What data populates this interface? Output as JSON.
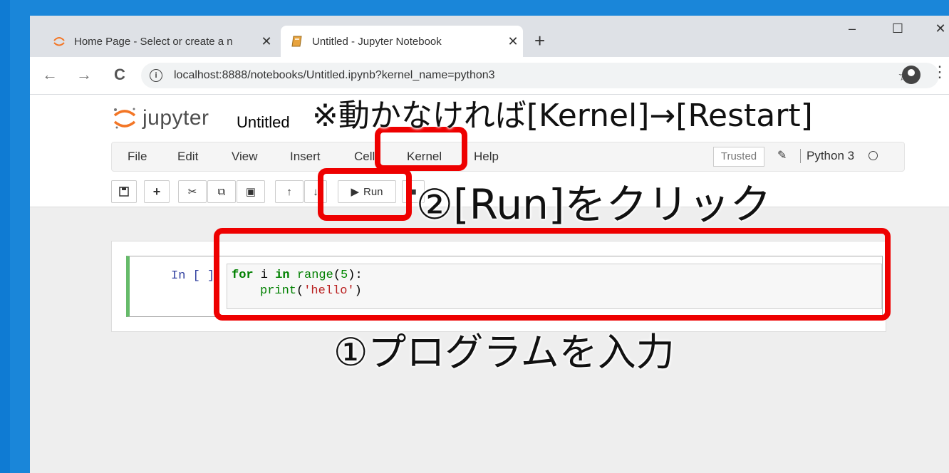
{
  "browser": {
    "tabs": [
      {
        "title": "Home Page - Select or create a n",
        "active": false,
        "close": "✕"
      },
      {
        "title": "Untitled - Jupyter Notebook",
        "active": true,
        "close": "✕"
      }
    ],
    "new_tab": "+",
    "window_controls": {
      "minimize": "–",
      "maximize": "☐",
      "close": "✕"
    },
    "nav": {
      "back": "←",
      "forward": "→",
      "reload": "C"
    },
    "url": "localhost:8888/notebooks/Untitled.ipynb?kernel_name=python3",
    "star": "☆",
    "menu": "⋮"
  },
  "jupyter": {
    "logo_text": "jupyter",
    "notebook_name": "Untitled",
    "menu": [
      "File",
      "Edit",
      "View",
      "Insert",
      "Cell",
      "Kernel",
      "Help"
    ],
    "trusted": "Trusted",
    "kernel_name": "Python 3",
    "toolbar": {
      "run_label": "Run"
    },
    "cell": {
      "prompt": "In [ ]:",
      "code_line1": {
        "kw1": "for",
        "var": " i ",
        "kw2": "in",
        "fn": " range",
        "open": "(",
        "num": "5",
        "close": "):"
      },
      "code_line2": {
        "fn": "print",
        "open": "(",
        "str": "'hello'",
        "close": ")"
      }
    }
  },
  "annotations": {
    "note": "※動かなければ[Kernel]→[Restart]",
    "step2": "②[Run]をクリック",
    "step1": "①プログラムを入力",
    "highlight_color": "#ee0000"
  }
}
